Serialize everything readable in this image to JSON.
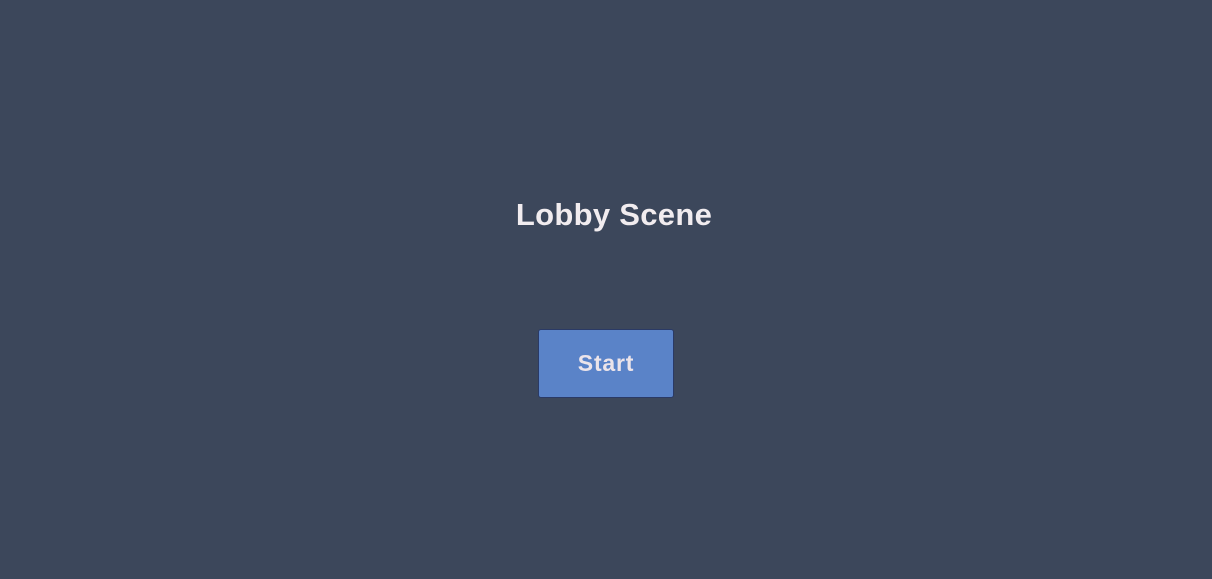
{
  "scene": {
    "title": "Lobby Scene",
    "start_label": "Start"
  },
  "colors": {
    "background": "#3c475b",
    "button": "#5a83c8",
    "text": "#f1ecef"
  }
}
